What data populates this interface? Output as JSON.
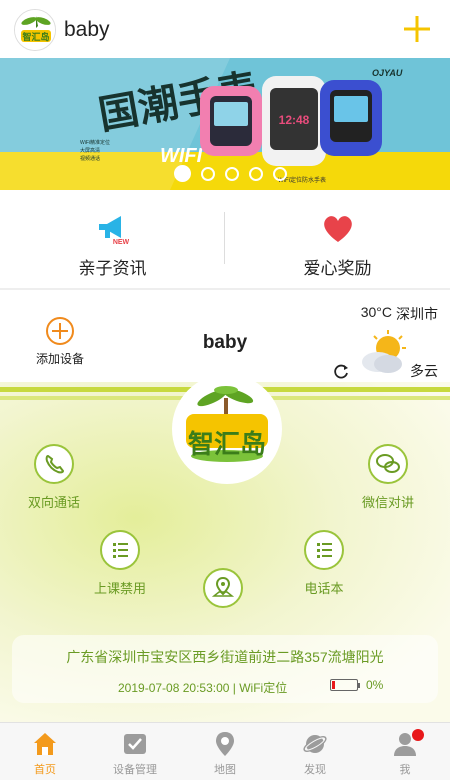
{
  "header": {
    "title": "baby"
  },
  "banner": {
    "headline": "国潮手表",
    "tagline": "WIFI",
    "brand": "OJYAU",
    "caption": "WiFi定位防水手表",
    "features": [
      "WiFi精准定位",
      "大屏高清",
      "视频通话"
    ],
    "active_slide": 1,
    "slide_count": 5
  },
  "quick_links": [
    {
      "label": "亲子资讯",
      "icon": "megaphone-icon",
      "badge": "NEW"
    },
    {
      "label": "爱心奖励",
      "icon": "heart-icon"
    }
  ],
  "device": {
    "add_label": "添加设备",
    "name": "baby",
    "logo_text": "智汇岛"
  },
  "weather": {
    "temperature": "30°C",
    "city": "深圳市",
    "condition": "多云"
  },
  "functions": [
    {
      "label": "双向通话",
      "icon": "phone-icon"
    },
    {
      "label": "微信对讲",
      "icon": "wechat-icon"
    },
    {
      "label": "上课禁用",
      "icon": "list-icon"
    },
    {
      "label": "电话本",
      "icon": "list-icon"
    },
    {
      "label": "",
      "icon": "location-map-icon"
    }
  ],
  "location": {
    "address": "广东省深圳市宝安区西乡街道前进二路357流塘阳光",
    "time": "2019-07-08 20:53:00 | WiFi定位",
    "battery": "0%",
    "battery_level": 0.05
  },
  "nav": [
    {
      "label": "首页",
      "icon": "home-icon",
      "active": true
    },
    {
      "label": "设备管理",
      "icon": "device-check-icon"
    },
    {
      "label": "地图",
      "icon": "map-pin-icon"
    },
    {
      "label": "发现",
      "icon": "planet-icon"
    },
    {
      "label": "我",
      "icon": "user-icon",
      "badge": true
    }
  ],
  "colors": {
    "accent_orange": "#f39a1c",
    "header_plus": "#f5c400",
    "leaf_green": "#6a9b24",
    "banner_yellow": "#f5d90a",
    "heart_red": "#e8434a"
  }
}
